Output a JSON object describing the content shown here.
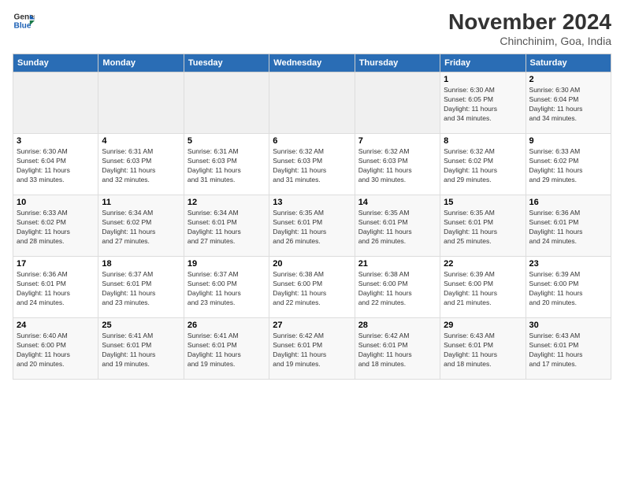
{
  "header": {
    "logo_line1": "General",
    "logo_line2": "Blue",
    "month_title": "November 2024",
    "subtitle": "Chinchinim, Goa, India"
  },
  "weekdays": [
    "Sunday",
    "Monday",
    "Tuesday",
    "Wednesday",
    "Thursday",
    "Friday",
    "Saturday"
  ],
  "weeks": [
    [
      {
        "day": "",
        "info": ""
      },
      {
        "day": "",
        "info": ""
      },
      {
        "day": "",
        "info": ""
      },
      {
        "day": "",
        "info": ""
      },
      {
        "day": "",
        "info": ""
      },
      {
        "day": "1",
        "info": "Sunrise: 6:30 AM\nSunset: 6:05 PM\nDaylight: 11 hours\nand 34 minutes."
      },
      {
        "day": "2",
        "info": "Sunrise: 6:30 AM\nSunset: 6:04 PM\nDaylight: 11 hours\nand 34 minutes."
      }
    ],
    [
      {
        "day": "3",
        "info": "Sunrise: 6:30 AM\nSunset: 6:04 PM\nDaylight: 11 hours\nand 33 minutes."
      },
      {
        "day": "4",
        "info": "Sunrise: 6:31 AM\nSunset: 6:03 PM\nDaylight: 11 hours\nand 32 minutes."
      },
      {
        "day": "5",
        "info": "Sunrise: 6:31 AM\nSunset: 6:03 PM\nDaylight: 11 hours\nand 31 minutes."
      },
      {
        "day": "6",
        "info": "Sunrise: 6:32 AM\nSunset: 6:03 PM\nDaylight: 11 hours\nand 31 minutes."
      },
      {
        "day": "7",
        "info": "Sunrise: 6:32 AM\nSunset: 6:03 PM\nDaylight: 11 hours\nand 30 minutes."
      },
      {
        "day": "8",
        "info": "Sunrise: 6:32 AM\nSunset: 6:02 PM\nDaylight: 11 hours\nand 29 minutes."
      },
      {
        "day": "9",
        "info": "Sunrise: 6:33 AM\nSunset: 6:02 PM\nDaylight: 11 hours\nand 29 minutes."
      }
    ],
    [
      {
        "day": "10",
        "info": "Sunrise: 6:33 AM\nSunset: 6:02 PM\nDaylight: 11 hours\nand 28 minutes."
      },
      {
        "day": "11",
        "info": "Sunrise: 6:34 AM\nSunset: 6:02 PM\nDaylight: 11 hours\nand 27 minutes."
      },
      {
        "day": "12",
        "info": "Sunrise: 6:34 AM\nSunset: 6:01 PM\nDaylight: 11 hours\nand 27 minutes."
      },
      {
        "day": "13",
        "info": "Sunrise: 6:35 AM\nSunset: 6:01 PM\nDaylight: 11 hours\nand 26 minutes."
      },
      {
        "day": "14",
        "info": "Sunrise: 6:35 AM\nSunset: 6:01 PM\nDaylight: 11 hours\nand 26 minutes."
      },
      {
        "day": "15",
        "info": "Sunrise: 6:35 AM\nSunset: 6:01 PM\nDaylight: 11 hours\nand 25 minutes."
      },
      {
        "day": "16",
        "info": "Sunrise: 6:36 AM\nSunset: 6:01 PM\nDaylight: 11 hours\nand 24 minutes."
      }
    ],
    [
      {
        "day": "17",
        "info": "Sunrise: 6:36 AM\nSunset: 6:01 PM\nDaylight: 11 hours\nand 24 minutes."
      },
      {
        "day": "18",
        "info": "Sunrise: 6:37 AM\nSunset: 6:01 PM\nDaylight: 11 hours\nand 23 minutes."
      },
      {
        "day": "19",
        "info": "Sunrise: 6:37 AM\nSunset: 6:00 PM\nDaylight: 11 hours\nand 23 minutes."
      },
      {
        "day": "20",
        "info": "Sunrise: 6:38 AM\nSunset: 6:00 PM\nDaylight: 11 hours\nand 22 minutes."
      },
      {
        "day": "21",
        "info": "Sunrise: 6:38 AM\nSunset: 6:00 PM\nDaylight: 11 hours\nand 22 minutes."
      },
      {
        "day": "22",
        "info": "Sunrise: 6:39 AM\nSunset: 6:00 PM\nDaylight: 11 hours\nand 21 minutes."
      },
      {
        "day": "23",
        "info": "Sunrise: 6:39 AM\nSunset: 6:00 PM\nDaylight: 11 hours\nand 20 minutes."
      }
    ],
    [
      {
        "day": "24",
        "info": "Sunrise: 6:40 AM\nSunset: 6:00 PM\nDaylight: 11 hours\nand 20 minutes."
      },
      {
        "day": "25",
        "info": "Sunrise: 6:41 AM\nSunset: 6:01 PM\nDaylight: 11 hours\nand 19 minutes."
      },
      {
        "day": "26",
        "info": "Sunrise: 6:41 AM\nSunset: 6:01 PM\nDaylight: 11 hours\nand 19 minutes."
      },
      {
        "day": "27",
        "info": "Sunrise: 6:42 AM\nSunset: 6:01 PM\nDaylight: 11 hours\nand 19 minutes."
      },
      {
        "day": "28",
        "info": "Sunrise: 6:42 AM\nSunset: 6:01 PM\nDaylight: 11 hours\nand 18 minutes."
      },
      {
        "day": "29",
        "info": "Sunrise: 6:43 AM\nSunset: 6:01 PM\nDaylight: 11 hours\nand 18 minutes."
      },
      {
        "day": "30",
        "info": "Sunrise: 6:43 AM\nSunset: 6:01 PM\nDaylight: 11 hours\nand 17 minutes."
      }
    ]
  ]
}
